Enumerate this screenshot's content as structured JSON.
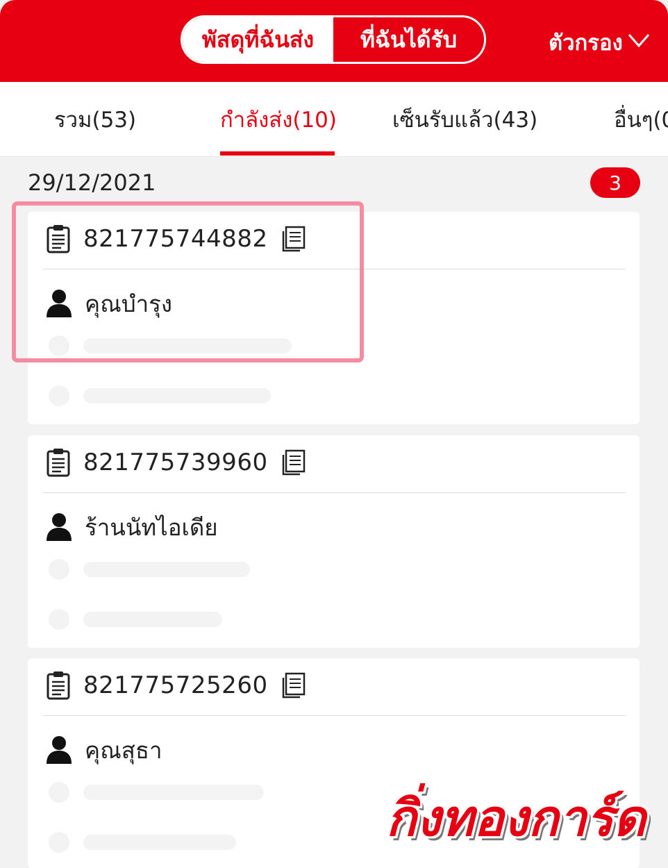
{
  "header": {
    "segment_sent": "พัสดุที่ฉันส่ง",
    "segment_received": "ที่ฉันได้รับ",
    "filter_label": "ตัวกรอง",
    "filter_icon": "chevron-down-icon"
  },
  "tabs": [
    {
      "label": "รวม(53)",
      "active": false
    },
    {
      "label": "กำลังส่ง(10)",
      "active": true
    },
    {
      "label": "เซ็นรับแล้ว(43)",
      "active": false
    },
    {
      "label": "อื่นๆ(0",
      "active": false
    }
  ],
  "group": {
    "date": "29/12/2021",
    "count": "3"
  },
  "parcels": [
    {
      "tracking": "821775744882",
      "recipient": "คุณบำรุง"
    },
    {
      "tracking": "821775739960",
      "recipient": "ร้านนัทไอเดีย"
    },
    {
      "tracking": "821775725260",
      "recipient": "คุณสุธา"
    }
  ],
  "watermark": "กิ่งทองการ์ด",
  "colors": {
    "brand_red": "#e60012",
    "highlight_pink": "#f48ba0"
  }
}
